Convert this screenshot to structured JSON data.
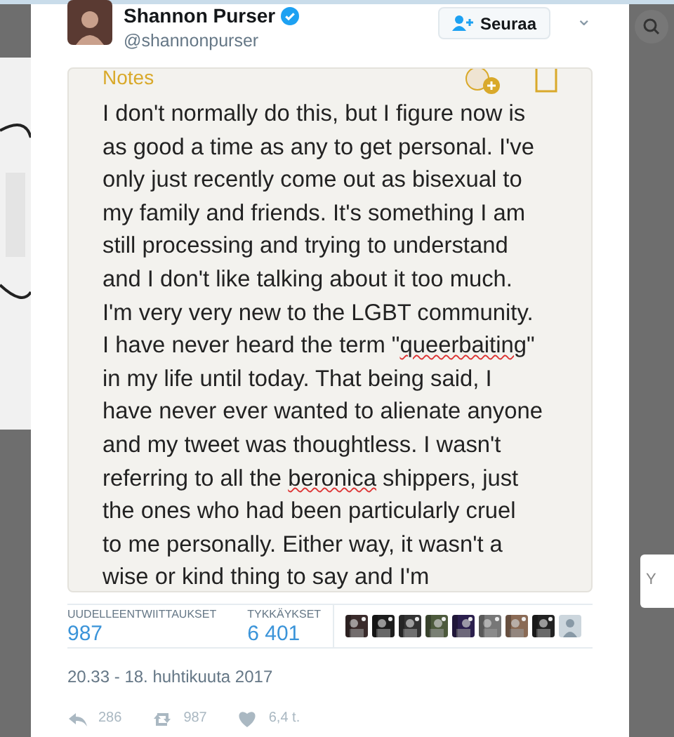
{
  "author": {
    "name": "Shannon Purser",
    "verified": true,
    "handle": "@shannonpurser"
  },
  "follow_button": {
    "label": "Seuraa"
  },
  "menu_caret": {
    "glyph": "⌄"
  },
  "notes": {
    "title": "Notes",
    "lines": [
      [
        {
          "text": "I don't normally do this, but I figure now is",
          "misspelled": false
        }
      ],
      [
        {
          "text": "as good a time as any to get personal. I've",
          "misspelled": false
        }
      ],
      [
        {
          "text": "only just recently come out as bisexual to",
          "misspelled": false
        }
      ],
      [
        {
          "text": "my family and friends. It's something I am",
          "misspelled": false
        }
      ],
      [
        {
          "text": "still processing and trying to understand",
          "misspelled": false
        }
      ],
      [
        {
          "text": "and I don't like talking about it too much.",
          "misspelled": false
        }
      ],
      [
        {
          "text": "I'm very very new to the LGBT community.",
          "misspelled": false
        }
      ],
      [
        {
          "text": "I have never heard the term \"",
          "misspelled": false
        },
        {
          "text": "queerbaiting",
          "misspelled": true
        },
        {
          "text": "\"",
          "misspelled": false
        }
      ],
      [
        {
          "text": "in my life until today. That being said, I",
          "misspelled": false
        }
      ],
      [
        {
          "text": "have never ever wanted to alienate anyone",
          "misspelled": false
        }
      ],
      [
        {
          "text": "and my tweet was thoughtless. I wasn't",
          "misspelled": false
        }
      ],
      [
        {
          "text": "referring to all the ",
          "misspelled": false
        },
        {
          "text": "beronica",
          "misspelled": true
        },
        {
          "text": " shippers, just",
          "misspelled": false
        }
      ],
      [
        {
          "text": "the ones who had been particularly cruel",
          "misspelled": false
        }
      ],
      [
        {
          "text": "to me personally. Either way, it wasn't a",
          "misspelled": false
        }
      ],
      [
        {
          "text": "wise or kind thing to say and I'm",
          "misspelled": false
        }
      ]
    ]
  },
  "stats": [
    {
      "label": "UUDELLEENTWIITTAUKSET",
      "value": "987"
    },
    {
      "label": "TYKKÄYKSET",
      "value": "6 401"
    }
  ],
  "likers": [
    {
      "kind": "picture"
    },
    {
      "kind": "picture"
    },
    {
      "kind": "picture"
    },
    {
      "kind": "picture"
    },
    {
      "kind": "picture"
    },
    {
      "kind": "picture"
    },
    {
      "kind": "picture"
    },
    {
      "kind": "picture"
    },
    {
      "kind": "default"
    }
  ],
  "timestamp": "20.33 - 18. huhtikuuta 2017",
  "actions": [
    {
      "kind": "reply",
      "count": "286"
    },
    {
      "kind": "retweet",
      "count": "987"
    },
    {
      "kind": "like",
      "count": "6,4 t."
    }
  ],
  "side_card": {
    "text": "Y"
  }
}
